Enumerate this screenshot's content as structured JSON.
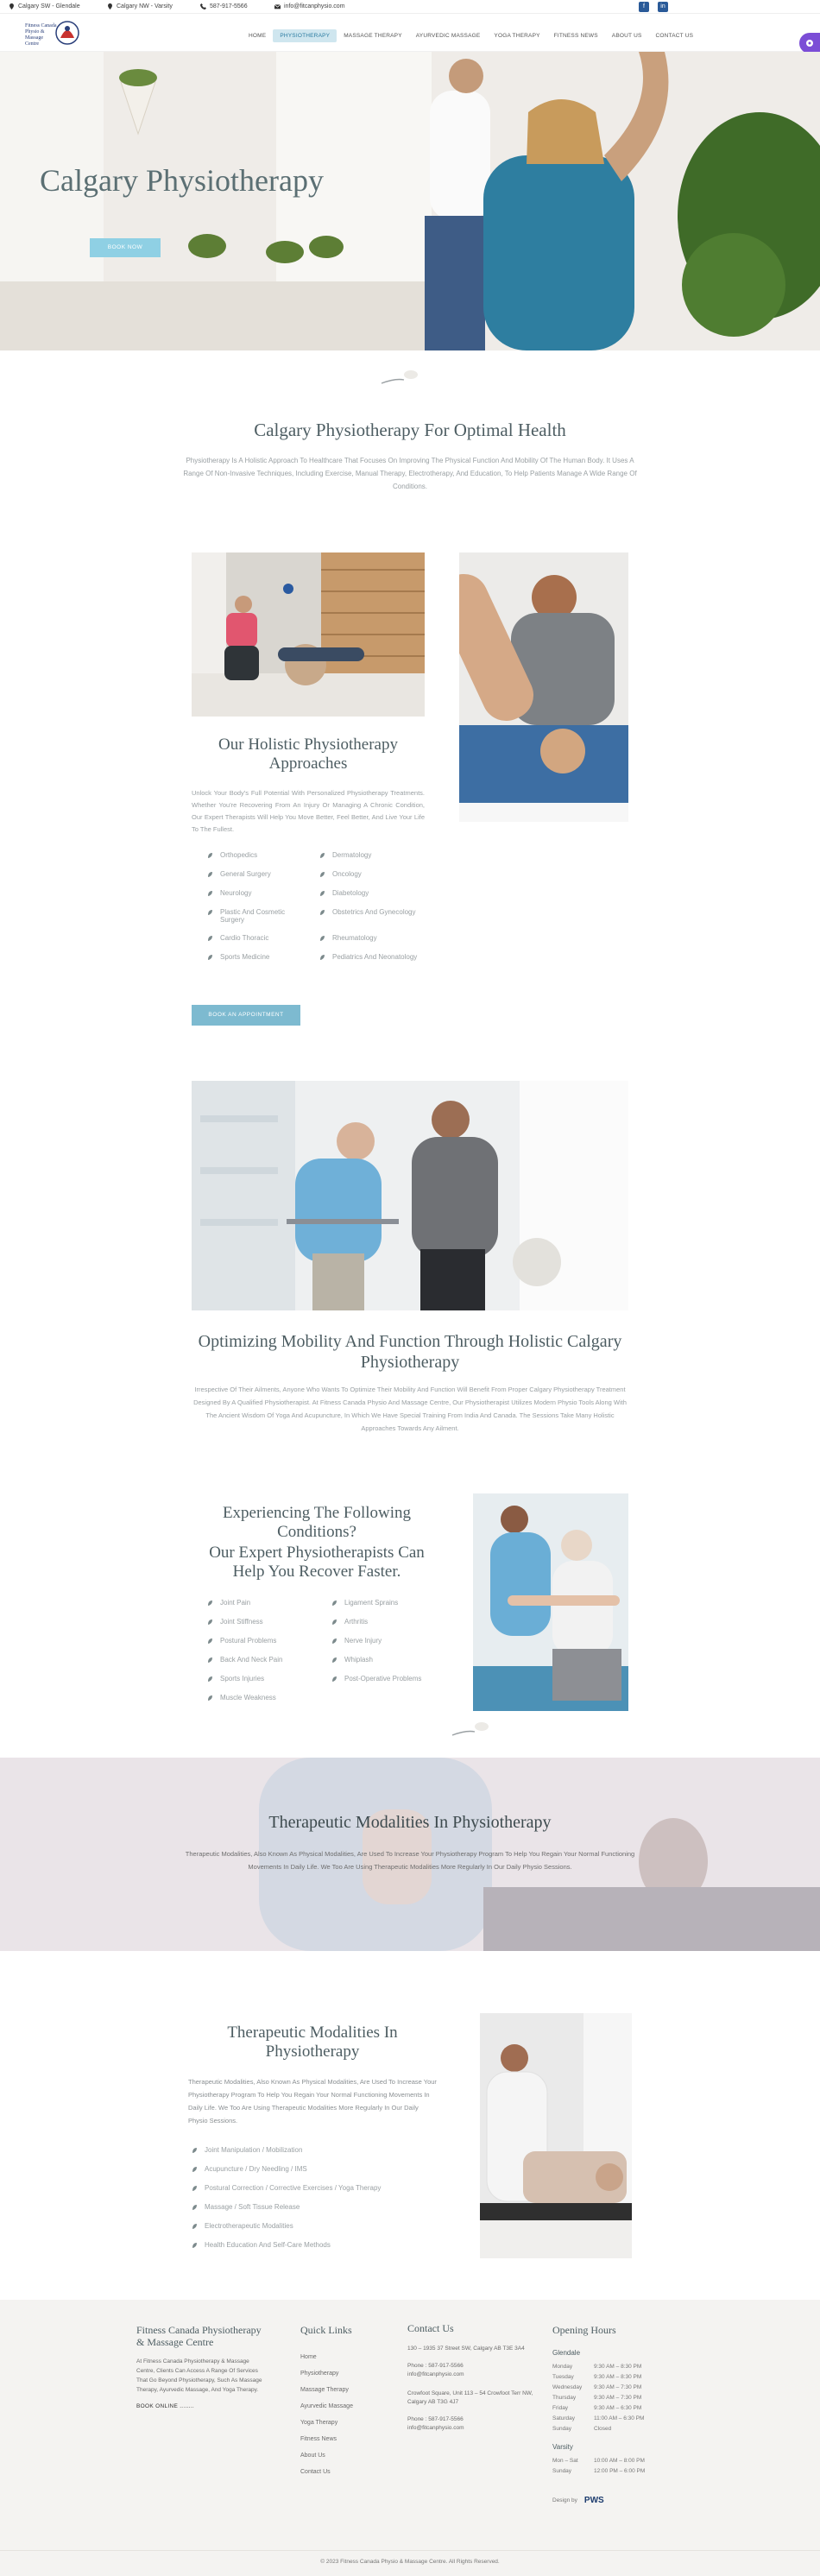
{
  "topbar": {
    "loc1": "Calgary SW - Glendale",
    "loc2": "Calgary NW - Varsity",
    "phone": "587-917-5566",
    "email": "info@fitcanphysio.com",
    "social1": "f",
    "social2": "in"
  },
  "nav": [
    "Home",
    "Physiotherapy",
    "Massage Therapy",
    "Ayurvedic Massage",
    "Yoga Therapy",
    "Fitness News",
    "About Us",
    "Contact Us"
  ],
  "hero": {
    "title": "Calgary Physiotherapy",
    "button": "BOOK NOW"
  },
  "intro": {
    "title": "Calgary Physiotherapy For Optimal Health",
    "text": "Physiotherapy Is A Holistic Approach To Healthcare That Focuses On Improving The Physical Function And Mobility Of The Human Body. It Uses A Range Of Non-Invasive Techniques, Including Exercise, Manual Therapy, Electrotherapy, And Education, To Help Patients Manage A Wide Range Of Conditions."
  },
  "holistic": {
    "title": "Our Holistic Physiotherapy Approaches",
    "text": "Unlock Your Body's Full Potential With Personalized Physiotherapy Treatments. Whether You're Recovering From An Injury Or Managing A Chronic Condition, Our Expert Therapists Will Help You Move Better, Feel Better, And Live Your Life To The Fullest.",
    "list_left": [
      "Orthopedics",
      "General Surgery",
      "Neurology",
      "Plastic And Cosmetic Surgery",
      "Cardio Thoracic",
      "Sports Medicine"
    ],
    "list_right": [
      "Dermatology",
      "Oncology",
      "Diabetology",
      "Obstetrics And Gynecology",
      "Rheumatology",
      "Pediatrics And Neonatology"
    ],
    "button": "BOOK AN APPOINTMENT"
  },
  "mobility": {
    "title": "Optimizing Mobility And Function Through Holistic Calgary Physiotherapy",
    "text": "Irrespective Of Their Ailments, Anyone Who Wants To Optimize Their Mobility And Function Will Benefit From Proper Calgary Physiotherapy Treatment Designed By A Qualified Physiotherapist. At Fitness Canada Physio And Massage Centre, Our Physiotherapist Utilizes Modern Physio Tools Along With The Ancient Wisdom Of Yoga And Acupuncture, In Which We Have Special Training From India And Canada. The Sessions Take Many Holistic Approaches Towards Any Ailment."
  },
  "conditions": {
    "title1": "Experiencing The Following Conditions?",
    "title2": "Our Expert Physiotherapists Can Help You Recover Faster.",
    "list_left": [
      "Joint Pain",
      "Joint Stiffness",
      "Postural Problems",
      "Back And Neck Pain",
      "Sports Injuries",
      "Muscle Weakness"
    ],
    "list_right": [
      "Ligament Sprains",
      "Arthritis",
      "Nerve Injury",
      "Whiplash",
      "Post-Operative Problems"
    ]
  },
  "modalities_banner": {
    "title": "Therapeutic Modalities In Physiotherapy",
    "text": "Therapeutic Modalities, Also Known As Physical Modalities, Are Used To Increase Your Physiotherapy Program To Help You Regain Your Normal Functioning Movements In Daily Life. We Too Are Using Therapeutic Modalities More Regularly In Our Daily Physio Sessions."
  },
  "modalities": {
    "title": "Therapeutic Modalities In Physiotherapy",
    "text": "Therapeutic Modalities, Also Known As Physical Modalities, Are Used To Increase Your Physiotherapy Program To Help You Regain Your Normal Functioning Movements In Daily Life. We Too Are Using Therapeutic Modalities More Regularly In Our Daily Physio Sessions.",
    "list": [
      "Joint Manipulation / Mobilization",
      "Acupuncture / Dry Needling / IMS",
      "Postural Correction / Corrective Exercises / Yoga Therapy",
      "Massage / Soft Tissue Release",
      "Electrotherapeutic Modalities",
      "Health Education And Self-Care Methods"
    ]
  },
  "footer": {
    "about_title": "Fitness Canada Physiotherapy & Massage Centre",
    "about_text": "At Fitness Canada Physiotherapy & Massage Centre, Clients Can Access A Range Of Services That Go Beyond Physiotherapy, Such As Massage Therapy, Ayurvedic Massage, And Yoga Therapy.",
    "book_online": "BOOK ONLINE ........",
    "links_title": "Quick Links",
    "links": [
      "Home",
      "Physiotherapy",
      "Massage Therapy",
      "Ayurvedic Massage",
      "Yoga Therapy",
      "Fitness News",
      "About Us",
      "Contact Us"
    ],
    "contact_title": "Contact Us",
    "addr1": "130 – 1935 37 Street SW, Calgary AB T3E 3A4",
    "phone1": "Phone : 587-917-5566",
    "email1": "info@fitcanphysio.com",
    "addr2": "Crowfoot Square, Unit 113 – 54 Crowfoot Terr NW, Calgary AB T3G 4J7",
    "phone2": "Phone : 587-917-5566",
    "email2": "info@fitcanphysio.com",
    "hours_title": "Opening Hours",
    "glendale": "Glendale",
    "hours_glendale": [
      [
        "Monday",
        "9:30 AM – 8:30 PM"
      ],
      [
        "Tuesday",
        "9:30 AM – 8:30 PM"
      ],
      [
        "Wednesday",
        "9:30 AM – 7:30 PM"
      ],
      [
        "Thursday",
        "9:30 AM – 7:30 PM"
      ],
      [
        "Friday",
        "9:30 AM – 6:30 PM"
      ],
      [
        "Saturday",
        "11:00 AM – 6:30 PM"
      ],
      [
        "Sunday",
        "Closed"
      ]
    ],
    "varsity": "Varsity",
    "hours_varsity": [
      [
        "Mon – Sat",
        "10:00 AM – 8:00 PM"
      ],
      [
        "Sunday",
        "12:00 PM – 6:00 PM"
      ]
    ],
    "design_by": "Design by",
    "design_logo": "PWS",
    "copyright": "© 2023 Fitness Canada Physio & Massage Centre. All Rights Reserved."
  }
}
